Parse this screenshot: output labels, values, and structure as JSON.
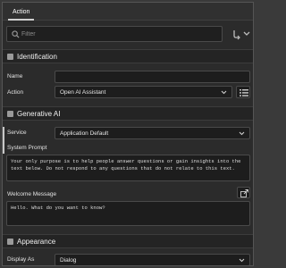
{
  "tabs": [
    {
      "label": "Action"
    }
  ],
  "filter": {
    "placeholder": "Filter"
  },
  "identification": {
    "title": "Identification",
    "name_label": "Name",
    "name_value": "",
    "action_label": "Action",
    "action_value": "Open AI Assistant"
  },
  "generative_ai": {
    "title": "Generative AI",
    "service_label": "Service",
    "service_value": "Application Default",
    "system_prompt_label": "System Prompt",
    "system_prompt_value": "Your only purpose is to help people answer questions or gain insights into the text below. Do not respond to any questions that do not relate to this text.",
    "welcome_label": "Welcome Message",
    "welcome_value": "Hello. What do you want to know?"
  },
  "appearance": {
    "title": "Appearance",
    "display_as_label": "Display As",
    "display_as_value": "Dialog"
  },
  "icons": [
    "search-icon",
    "filter-menu-icon",
    "chevron-down-icon",
    "list-icon",
    "expand-icon"
  ]
}
